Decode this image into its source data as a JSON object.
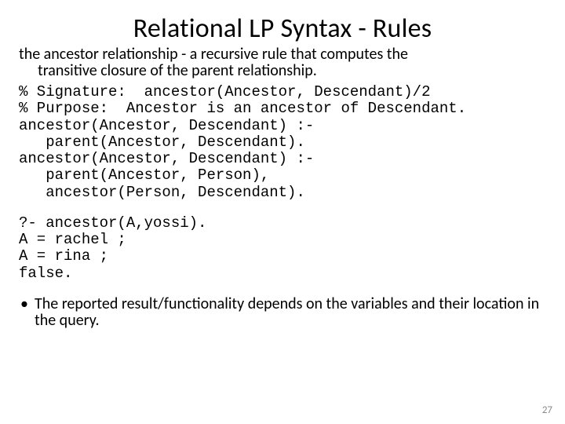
{
  "title": "Relational LP Syntax - Rules",
  "subtitle_line1": "the ancestor relationship - a recursive rule that computes the",
  "subtitle_line2": "transitive closure of the parent relationship.",
  "code_block1": "% Signature:  ancestor(Ancestor, Descendant)/2\n% Purpose:  Ancestor is an ancestor of Descendant.\nancestor(Ancestor, Descendant) :-\n   parent(Ancestor, Descendant).\nancestor(Ancestor, Descendant) :-\n   parent(Ancestor, Person),\n   ancestor(Person, Descendant).",
  "code_block2": "?- ancestor(A,yossi).\nA = rachel ;\nA = rina ;\nfalse.",
  "bullet_dot": "•",
  "bullet_text": "The reported result/functionality depends on the variables and their location in the query.",
  "page_number": "27"
}
